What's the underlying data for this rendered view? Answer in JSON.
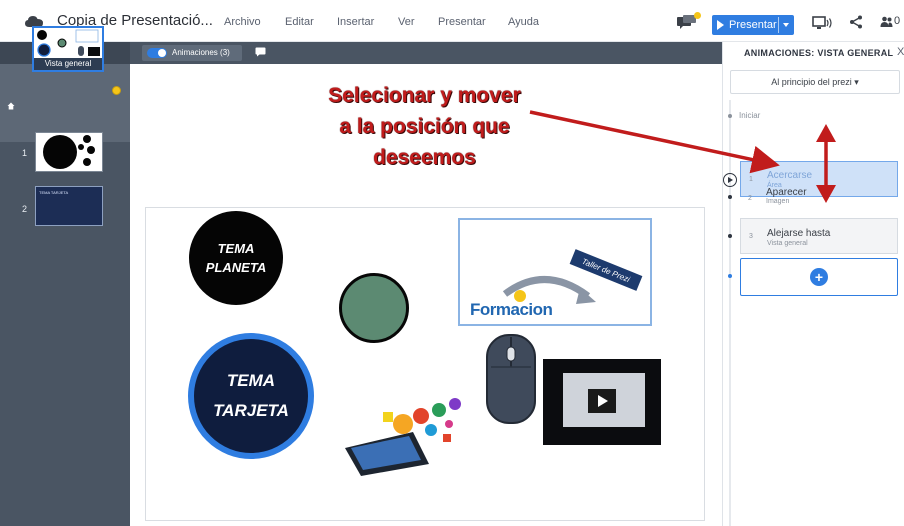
{
  "topbar": {
    "title": "Copia de Presentació...",
    "menu": [
      "Archivo",
      "Editar",
      "Insertar",
      "Ver",
      "Presentar",
      "Ayuda"
    ],
    "present_label": "Presentar",
    "users_suffix": "0"
  },
  "sidebar": {
    "header": "Vista general",
    "overview_label": "Vista general",
    "slides": [
      {
        "number": "1"
      },
      {
        "number": "2",
        "thumb_text": "TEMA TARJETA"
      }
    ]
  },
  "canvas_toolbar": {
    "animations_label": "Animaciones (3)"
  },
  "canvas": {
    "planeta_line1": "TEMA",
    "planeta_line2": "PLANETA",
    "tarjeta_line1": "TEMA",
    "tarjeta_line2": "TARJETA",
    "formacion": "Formacion",
    "taller": "Taller de Prezi"
  },
  "callout": {
    "lines": [
      "Selecionar y mover",
      "a la posición que",
      "deseemos"
    ],
    "color": "#c11c1c"
  },
  "panel": {
    "title": "ANIMACIONES: VISTA GENERAL",
    "close": "X",
    "dropdown": "Al principio del prezi ▾",
    "start_label": "Iniciar",
    "steps": [
      {
        "number": "1",
        "title": "Acercarse",
        "subtitle": "Área"
      },
      {
        "number": "2",
        "title": "Aparecer",
        "subtitle": "Imagen"
      },
      {
        "number": "3",
        "title": "Alejarse hasta",
        "subtitle": "Vista general"
      }
    ],
    "add_label": "+"
  },
  "colors": {
    "accent": "#2f7de1",
    "sidebar": "#4a5563",
    "arrow": "#c11c1c"
  }
}
